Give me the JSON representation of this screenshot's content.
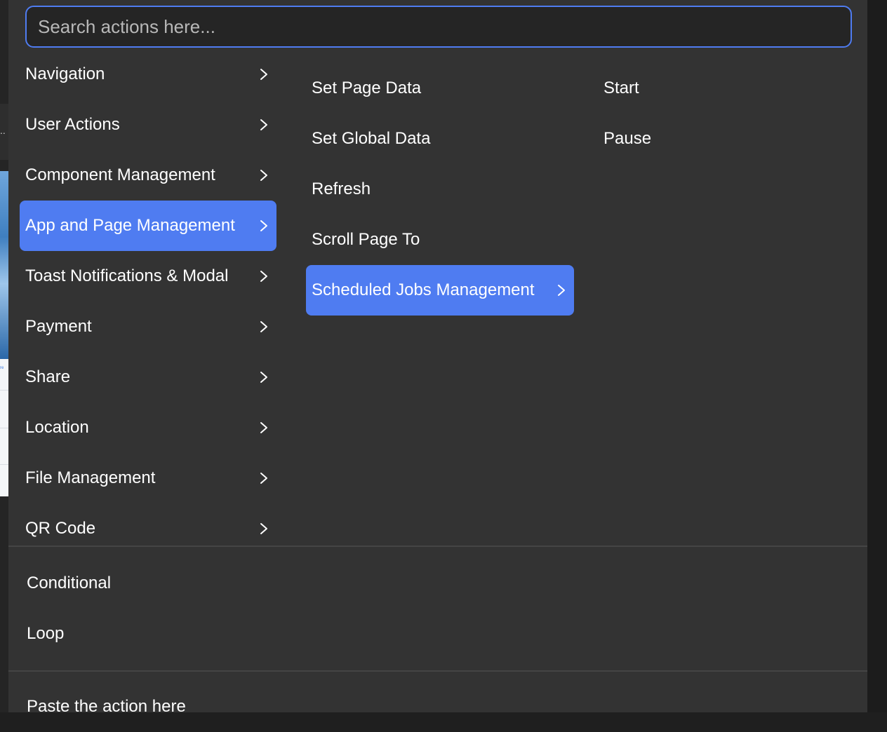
{
  "search": {
    "placeholder": "Search actions here..."
  },
  "categories": [
    {
      "label": "Navigation"
    },
    {
      "label": "User Actions"
    },
    {
      "label": "Component Management"
    },
    {
      "label": "App and Page Management"
    },
    {
      "label": "Toast Notifications & Modal"
    },
    {
      "label": "Payment"
    },
    {
      "label": "Share"
    },
    {
      "label": "Location"
    },
    {
      "label": "File Management"
    },
    {
      "label": "QR Code"
    }
  ],
  "active_category": "App and Page Management",
  "subactions": [
    {
      "label": "Set Page Data"
    },
    {
      "label": "Set Global Data"
    },
    {
      "label": "Refresh"
    },
    {
      "label": "Scroll Page To"
    },
    {
      "label": "Scheduled Jobs Management"
    }
  ],
  "active_subaction": "Scheduled Jobs Management",
  "jobs_actions": [
    {
      "label": "Start"
    },
    {
      "label": "Pause"
    }
  ],
  "logic": [
    {
      "label": "Conditional"
    },
    {
      "label": "Loop"
    }
  ],
  "paste": {
    "label": "Paste the action here"
  },
  "background": {
    "ellipsis": "..",
    "link": "re"
  },
  "colors": {
    "accent": "#4f7cf1",
    "panel": "#333333",
    "search_bg": "#252525",
    "text": "#ffffff"
  }
}
